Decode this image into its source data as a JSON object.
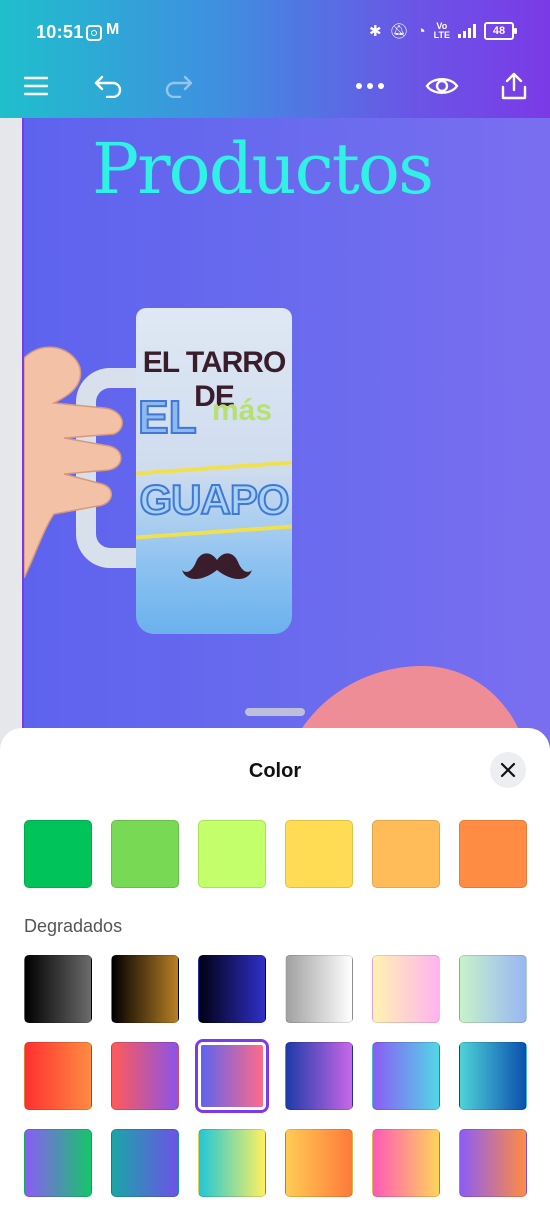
{
  "status": {
    "time": "10:51",
    "battery": "48",
    "volte_top": "Vo",
    "volte_bottom": "LTE"
  },
  "toolbar": {
    "icons": [
      "menu-icon",
      "undo-icon",
      "redo-icon",
      "more-icon",
      "preview-eye-icon",
      "share-upload-icon"
    ]
  },
  "design": {
    "title": "Productos",
    "mug": {
      "line1": "EL TARRO DE",
      "line2": "EL",
      "line2b": "más",
      "line3": "GUAPO"
    }
  },
  "sheet": {
    "title": "Color",
    "solid_colors": [
      "#00c35a",
      "#78d955",
      "#c2ff6b",
      "#ffdc53",
      "#ffbc59",
      "#ff8c42"
    ],
    "section_label": "Degradados",
    "gradients": [
      [
        "#000000",
        "#6b6b6b"
      ],
      [
        "#000000",
        "#b98025"
      ],
      [
        "#000014",
        "#3030c8"
      ],
      [
        "#a0a0a0",
        "#ffffff"
      ],
      [
        "#fff3b0",
        "#ffb3f0"
      ],
      [
        "#c7f2c9",
        "#98b6f5"
      ],
      [
        "#ff3030",
        "#ff8c42"
      ],
      [
        "#ff5a5a",
        "#8a54e8"
      ],
      [
        "#5e63ee",
        "#ff6b8a"
      ],
      [
        "#1d3ba8",
        "#c868e8"
      ],
      [
        "#8a5cf5",
        "#52d7e6"
      ],
      [
        "#4fd3d8",
        "#0b4fae"
      ],
      [
        "#8c5cf6",
        "#15c56b"
      ],
      [
        "#1aa6a6",
        "#6d52e6"
      ],
      [
        "#20c7d8",
        "#fff060"
      ],
      [
        "#ffcc55",
        "#ff7a3a"
      ],
      [
        "#ff5ab8",
        "#ffd45a"
      ],
      [
        "#8c5cf6",
        "#ff8c42"
      ]
    ],
    "selected_gradient": 8
  }
}
